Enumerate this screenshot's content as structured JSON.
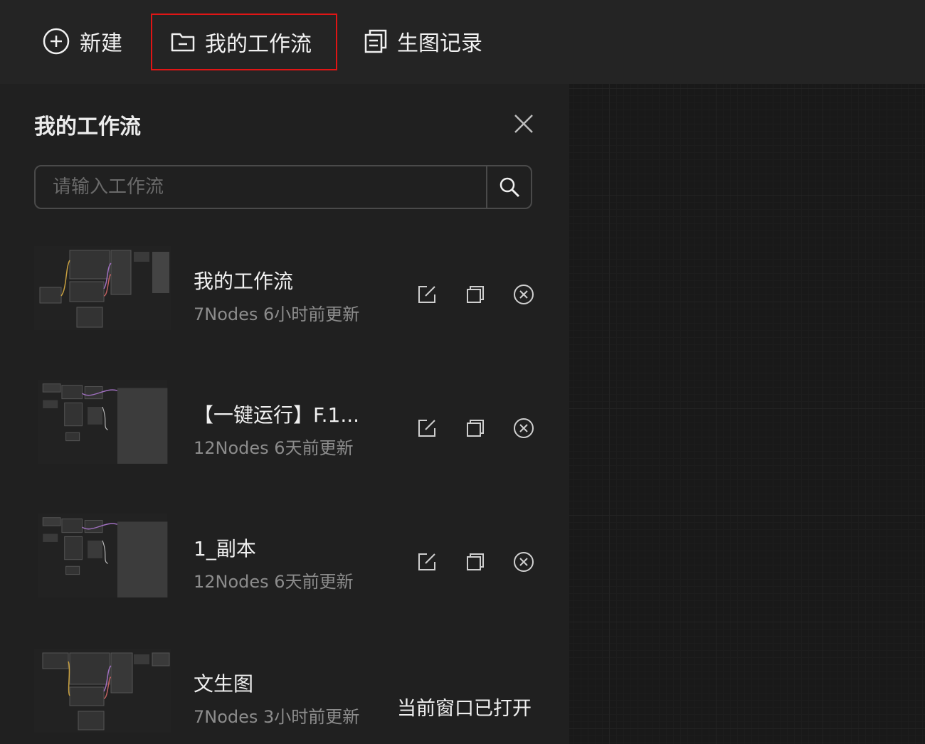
{
  "topbar": {
    "new_label": "新建",
    "my_workflows_label": "我的工作流",
    "history_label": "生图记录"
  },
  "panel": {
    "title": "我的工作流",
    "search_placeholder": "请输入工作流"
  },
  "workflows": [
    {
      "name": "我的工作流",
      "meta": "7Nodes 6小时前更新",
      "status": ""
    },
    {
      "name": "【一键运行】F.1...",
      "meta": "12Nodes 6天前更新",
      "status": ""
    },
    {
      "name": "1_副本",
      "meta": "12Nodes 6天前更新",
      "status": ""
    },
    {
      "name": "文生图",
      "meta": "7Nodes 3小时前更新",
      "status": "当前窗口已打开"
    }
  ],
  "colors": {
    "highlight_border": "#e01515",
    "panel_bg": "#202020",
    "topbar_bg": "#242424"
  },
  "icons": [
    "plus-circle-icon",
    "folder-icon",
    "history-icon",
    "close-icon",
    "search-icon",
    "edit-icon",
    "copy-icon",
    "delete-icon"
  ]
}
